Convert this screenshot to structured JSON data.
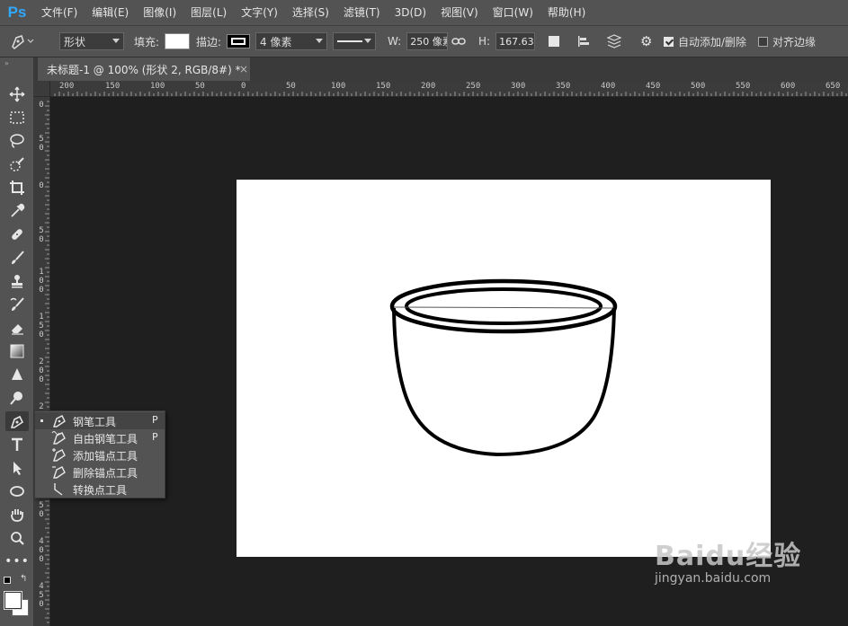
{
  "app": {
    "logo": "Ps"
  },
  "menu": [
    "文件(F)",
    "编辑(E)",
    "图像(I)",
    "图层(L)",
    "文字(Y)",
    "选择(S)",
    "滤镜(T)",
    "3D(D)",
    "视图(V)",
    "窗口(W)",
    "帮助(H)"
  ],
  "options": {
    "mode": "形状",
    "fill_label": "填充:",
    "stroke_label": "描边:",
    "stroke_width": "4 像素",
    "w_label": "W:",
    "w_value": "250 像素",
    "h_label": "H:",
    "h_value": "167.63 像",
    "auto_add_delete": "自动添加/删除",
    "auto_add_checked": true,
    "align_edges": "对齐边缘",
    "align_edges_checked": false
  },
  "document": {
    "tab_title": "未标题-1 @ 100% (形状 2, RGB/8#) *",
    "close": "×"
  },
  "ruler_h": [
    "200",
    "150",
    "100",
    "50",
    "0",
    "50",
    "100",
    "150",
    "200",
    "250",
    "300",
    "350",
    "400",
    "450",
    "500",
    "550",
    "600",
    "650"
  ],
  "ruler_v": [
    "0",
    "50",
    "0",
    "50",
    "100",
    "150",
    "200",
    "250",
    "300",
    "350",
    "400",
    "450"
  ],
  "flyout": [
    {
      "label": "钢笔工具",
      "key": "P",
      "icon": "pen-icon",
      "selected": true
    },
    {
      "label": "自由钢笔工具",
      "key": "P",
      "icon": "freeform-pen-icon",
      "selected": false
    },
    {
      "label": "添加锚点工具",
      "key": "",
      "icon": "add-anchor-icon",
      "selected": false
    },
    {
      "label": "删除锚点工具",
      "key": "",
      "icon": "delete-anchor-icon",
      "selected": false
    },
    {
      "label": "转换点工具",
      "key": "",
      "icon": "convert-point-icon",
      "selected": false
    }
  ],
  "watermark": {
    "main": "Baidu经验",
    "sub": "jingyan.baidu.com"
  },
  "colors": {
    "accent": "#31a8ff",
    "panel": "#535353",
    "workspace": "#1f1f1f"
  }
}
